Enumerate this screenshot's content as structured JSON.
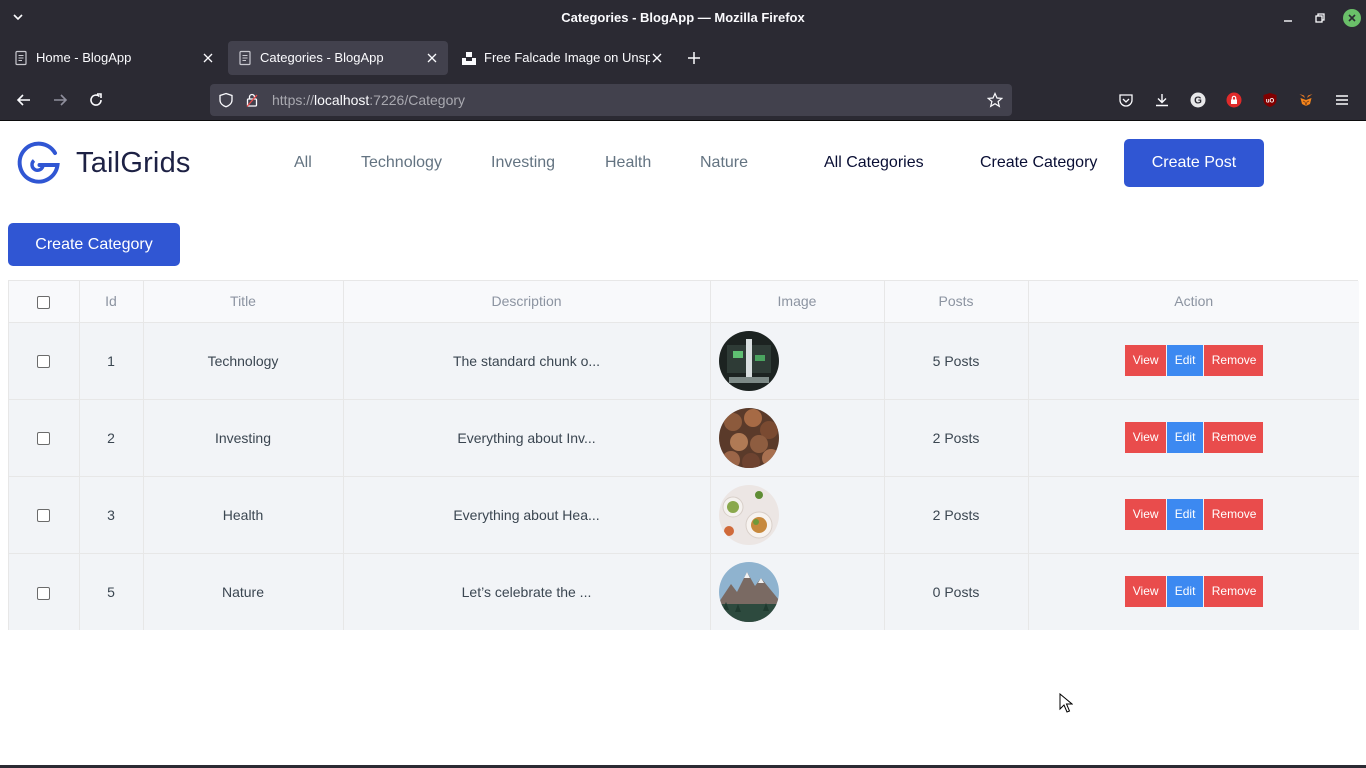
{
  "window": {
    "title": "Categories - BlogApp — Mozilla Firefox"
  },
  "tabs": [
    {
      "label": "Home - BlogApp"
    },
    {
      "label": "Categories - BlogApp"
    },
    {
      "label": "Free Falcade Image on Unsp"
    }
  ],
  "address": {
    "scheme": "https://",
    "host": "localhost",
    "path": ":7226/Category"
  },
  "site": {
    "logo_text": "TailGrids",
    "nav": {
      "all": "All",
      "technology": "Technology",
      "investing": "Investing",
      "health": "Health",
      "nature": "Nature",
      "all_categories": "All Categories",
      "create_category": "Create Category",
      "create_post": "Create Post"
    }
  },
  "main": {
    "create_category_label": "Create Category",
    "table": {
      "headers": {
        "id": "Id",
        "title": "Title",
        "description": "Description",
        "image": "Image",
        "posts": "Posts",
        "action": "Action"
      },
      "rows": [
        {
          "id": "1",
          "title": "Technology",
          "description": "The standard chunk o...",
          "posts": "5 Posts"
        },
        {
          "id": "2",
          "title": "Investing",
          "description": "Everything about Inv...",
          "posts": "2 Posts"
        },
        {
          "id": "3",
          "title": "Health",
          "description": "Everything about Hea...",
          "posts": "2 Posts"
        },
        {
          "id": "5",
          "title": "Nature",
          "description": "Let’s celebrate the ...",
          "posts": "0 Posts"
        }
      ],
      "actions": {
        "view": "View",
        "edit": "Edit",
        "remove": "Remove"
      }
    }
  },
  "colors": {
    "primary": "#3056d3",
    "danger": "#e94c4c",
    "info": "#3c89f1"
  },
  "icons": [
    "chevron-down-icon",
    "page-icon",
    "close-icon",
    "plus-icon",
    "back-icon",
    "forward-icon",
    "reload-icon",
    "shield-icon",
    "lock-icon",
    "star-icon",
    "pocket-icon",
    "download-icon",
    "grammarly-icon",
    "extension-icon",
    "ublock-icon",
    "metamask-icon",
    "hamburger-icon"
  ]
}
